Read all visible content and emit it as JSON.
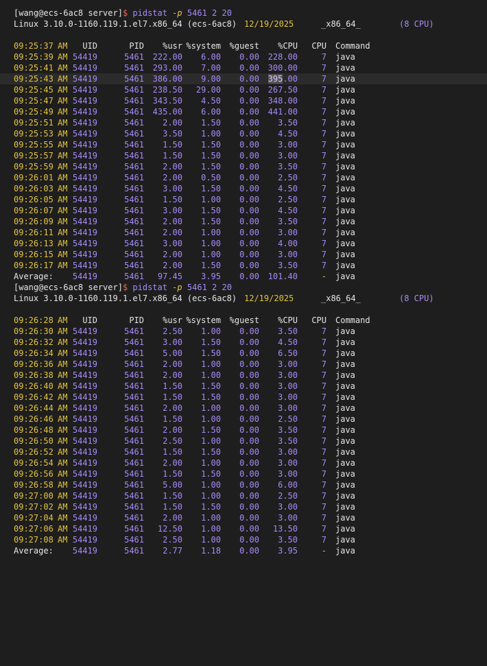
{
  "colors": {
    "background": "#1e1e1e",
    "time": "#e4c440",
    "number": "#a78bfa",
    "text": "#e6e6e6",
    "prompt_red": "#ff5f56"
  },
  "top_partial_line": "",
  "session1": {
    "prompt": {
      "open": "[wang@ecs-6ac8 server]",
      "dollar": "$ ",
      "command": "pidstat",
      "flag": " -p ",
      "args": "5461 2 20"
    },
    "sysinfo": {
      "kernel": "Linux 3.10.0-1160.119.1.el7.x86_64 (ecs-6ac8)",
      "date": "12/19/2025",
      "arch": "_x86_64_",
      "cpus": "(8 CPU)"
    },
    "header": {
      "time": "09:25:37",
      "ampm": "AM",
      "uid": "UID",
      "pid": "PID",
      "usr": "%usr",
      "system": "%system",
      "guest": "%guest",
      "cpu_pct": "%CPU",
      "cpu": "CPU",
      "command": "Command"
    },
    "rows": [
      {
        "time": "09:25:39",
        "ampm": "AM",
        "uid": "54419",
        "pid": "5461",
        "usr": "222.00",
        "system": "6.00",
        "guest": "0.00",
        "cpu_pct": "228.00",
        "cpu": "7",
        "command": "java"
      },
      {
        "time": "09:25:41",
        "ampm": "AM",
        "uid": "54419",
        "pid": "5461",
        "usr": "293.00",
        "system": "7.00",
        "guest": "0.00",
        "cpu_pct": "300.00",
        "cpu": "7",
        "command": "java"
      },
      {
        "time": "09:25:43",
        "ampm": "AM",
        "uid": "54419",
        "pid": "5461",
        "usr": "386.00",
        "system": "9.00",
        "guest": "0.00",
        "cpu_pct": "395.00",
        "cpu": "7",
        "command": "java"
      },
      {
        "time": "09:25:45",
        "ampm": "AM",
        "uid": "54419",
        "pid": "5461",
        "usr": "238.50",
        "system": "29.00",
        "guest": "0.00",
        "cpu_pct": "267.50",
        "cpu": "7",
        "command": "java"
      },
      {
        "time": "09:25:47",
        "ampm": "AM",
        "uid": "54419",
        "pid": "5461",
        "usr": "343.50",
        "system": "4.50",
        "guest": "0.00",
        "cpu_pct": "348.00",
        "cpu": "7",
        "command": "java"
      },
      {
        "time": "09:25:49",
        "ampm": "AM",
        "uid": "54419",
        "pid": "5461",
        "usr": "435.00",
        "system": "6.00",
        "guest": "0.00",
        "cpu_pct": "441.00",
        "cpu": "7",
        "command": "java"
      },
      {
        "time": "09:25:51",
        "ampm": "AM",
        "uid": "54419",
        "pid": "5461",
        "usr": "2.00",
        "system": "1.50",
        "guest": "0.00",
        "cpu_pct": "3.50",
        "cpu": "7",
        "command": "java"
      },
      {
        "time": "09:25:53",
        "ampm": "AM",
        "uid": "54419",
        "pid": "5461",
        "usr": "3.50",
        "system": "1.00",
        "guest": "0.00",
        "cpu_pct": "4.50",
        "cpu": "7",
        "command": "java"
      },
      {
        "time": "09:25:55",
        "ampm": "AM",
        "uid": "54419",
        "pid": "5461",
        "usr": "1.50",
        "system": "1.50",
        "guest": "0.00",
        "cpu_pct": "3.00",
        "cpu": "7",
        "command": "java"
      },
      {
        "time": "09:25:57",
        "ampm": "AM",
        "uid": "54419",
        "pid": "5461",
        "usr": "1.50",
        "system": "1.50",
        "guest": "0.00",
        "cpu_pct": "3.00",
        "cpu": "7",
        "command": "java"
      },
      {
        "time": "09:25:59",
        "ampm": "AM",
        "uid": "54419",
        "pid": "5461",
        "usr": "2.00",
        "system": "1.50",
        "guest": "0.00",
        "cpu_pct": "3.50",
        "cpu": "7",
        "command": "java"
      },
      {
        "time": "09:26:01",
        "ampm": "AM",
        "uid": "54419",
        "pid": "5461",
        "usr": "2.00",
        "system": "0.50",
        "guest": "0.00",
        "cpu_pct": "2.50",
        "cpu": "7",
        "command": "java"
      },
      {
        "time": "09:26:03",
        "ampm": "AM",
        "uid": "54419",
        "pid": "5461",
        "usr": "3.00",
        "system": "1.50",
        "guest": "0.00",
        "cpu_pct": "4.50",
        "cpu": "7",
        "command": "java"
      },
      {
        "time": "09:26:05",
        "ampm": "AM",
        "uid": "54419",
        "pid": "5461",
        "usr": "1.50",
        "system": "1.00",
        "guest": "0.00",
        "cpu_pct": "2.50",
        "cpu": "7",
        "command": "java"
      },
      {
        "time": "09:26:07",
        "ampm": "AM",
        "uid": "54419",
        "pid": "5461",
        "usr": "3.00",
        "system": "1.50",
        "guest": "0.00",
        "cpu_pct": "4.50",
        "cpu": "7",
        "command": "java"
      },
      {
        "time": "09:26:09",
        "ampm": "AM",
        "uid": "54419",
        "pid": "5461",
        "usr": "2.00",
        "system": "1.50",
        "guest": "0.00",
        "cpu_pct": "3.50",
        "cpu": "7",
        "command": "java"
      },
      {
        "time": "09:26:11",
        "ampm": "AM",
        "uid": "54419",
        "pid": "5461",
        "usr": "2.00",
        "system": "1.00",
        "guest": "0.00",
        "cpu_pct": "3.00",
        "cpu": "7",
        "command": "java"
      },
      {
        "time": "09:26:13",
        "ampm": "AM",
        "uid": "54419",
        "pid": "5461",
        "usr": "3.00",
        "system": "1.00",
        "guest": "0.00",
        "cpu_pct": "4.00",
        "cpu": "7",
        "command": "java"
      },
      {
        "time": "09:26:15",
        "ampm": "AM",
        "uid": "54419",
        "pid": "5461",
        "usr": "2.00",
        "system": "1.00",
        "guest": "0.00",
        "cpu_pct": "3.00",
        "cpu": "7",
        "command": "java"
      },
      {
        "time": "09:26:17",
        "ampm": "AM",
        "uid": "54419",
        "pid": "5461",
        "usr": "2.00",
        "system": "1.50",
        "guest": "0.00",
        "cpu_pct": "3.50",
        "cpu": "7",
        "command": "java"
      }
    ],
    "average": {
      "label": "Average:",
      "uid": "54419",
      "pid": "5461",
      "usr": "97.45",
      "system": "3.95",
      "guest": "0.00",
      "cpu_pct": "101.40",
      "cpu": "-",
      "command": "java"
    }
  },
  "session2": {
    "prompt": {
      "open": "[wang@ecs-6ac8 server]",
      "dollar": "$ ",
      "command": "pidstat",
      "flag": " -p ",
      "args": "5461 2 20"
    },
    "sysinfo": {
      "kernel": "Linux 3.10.0-1160.119.1.el7.x86_64 (ecs-6ac8)",
      "date": "12/19/2025",
      "arch": "_x86_64_",
      "cpus": "(8 CPU)"
    },
    "header": {
      "time": "09:26:28",
      "ampm": "AM",
      "uid": "UID",
      "pid": "PID",
      "usr": "%usr",
      "system": "%system",
      "guest": "%guest",
      "cpu_pct": "%CPU",
      "cpu": "CPU",
      "command": "Command"
    },
    "rows": [
      {
        "time": "09:26:30",
        "ampm": "AM",
        "uid": "54419",
        "pid": "5461",
        "usr": "2.50",
        "system": "1.00",
        "guest": "0.00",
        "cpu_pct": "3.50",
        "cpu": "7",
        "command": "java"
      },
      {
        "time": "09:26:32",
        "ampm": "AM",
        "uid": "54419",
        "pid": "5461",
        "usr": "3.00",
        "system": "1.50",
        "guest": "0.00",
        "cpu_pct": "4.50",
        "cpu": "7",
        "command": "java"
      },
      {
        "time": "09:26:34",
        "ampm": "AM",
        "uid": "54419",
        "pid": "5461",
        "usr": "5.00",
        "system": "1.50",
        "guest": "0.00",
        "cpu_pct": "6.50",
        "cpu": "7",
        "command": "java"
      },
      {
        "time": "09:26:36",
        "ampm": "AM",
        "uid": "54419",
        "pid": "5461",
        "usr": "2.00",
        "system": "1.00",
        "guest": "0.00",
        "cpu_pct": "3.00",
        "cpu": "7",
        "command": "java"
      },
      {
        "time": "09:26:38",
        "ampm": "AM",
        "uid": "54419",
        "pid": "5461",
        "usr": "2.00",
        "system": "1.00",
        "guest": "0.00",
        "cpu_pct": "3.00",
        "cpu": "7",
        "command": "java"
      },
      {
        "time": "09:26:40",
        "ampm": "AM",
        "uid": "54419",
        "pid": "5461",
        "usr": "1.50",
        "system": "1.50",
        "guest": "0.00",
        "cpu_pct": "3.00",
        "cpu": "7",
        "command": "java"
      },
      {
        "time": "09:26:42",
        "ampm": "AM",
        "uid": "54419",
        "pid": "5461",
        "usr": "1.50",
        "system": "1.50",
        "guest": "0.00",
        "cpu_pct": "3.00",
        "cpu": "7",
        "command": "java"
      },
      {
        "time": "09:26:44",
        "ampm": "AM",
        "uid": "54419",
        "pid": "5461",
        "usr": "2.00",
        "system": "1.00",
        "guest": "0.00",
        "cpu_pct": "3.00",
        "cpu": "7",
        "command": "java"
      },
      {
        "time": "09:26:46",
        "ampm": "AM",
        "uid": "54419",
        "pid": "5461",
        "usr": "1.50",
        "system": "1.00",
        "guest": "0.00",
        "cpu_pct": "2.50",
        "cpu": "7",
        "command": "java"
      },
      {
        "time": "09:26:48",
        "ampm": "AM",
        "uid": "54419",
        "pid": "5461",
        "usr": "2.00",
        "system": "1.50",
        "guest": "0.00",
        "cpu_pct": "3.50",
        "cpu": "7",
        "command": "java"
      },
      {
        "time": "09:26:50",
        "ampm": "AM",
        "uid": "54419",
        "pid": "5461",
        "usr": "2.50",
        "system": "1.00",
        "guest": "0.00",
        "cpu_pct": "3.50",
        "cpu": "7",
        "command": "java"
      },
      {
        "time": "09:26:52",
        "ampm": "AM",
        "uid": "54419",
        "pid": "5461",
        "usr": "1.50",
        "system": "1.50",
        "guest": "0.00",
        "cpu_pct": "3.00",
        "cpu": "7",
        "command": "java"
      },
      {
        "time": "09:26:54",
        "ampm": "AM",
        "uid": "54419",
        "pid": "5461",
        "usr": "2.00",
        "system": "1.00",
        "guest": "0.00",
        "cpu_pct": "3.00",
        "cpu": "7",
        "command": "java"
      },
      {
        "time": "09:26:56",
        "ampm": "AM",
        "uid": "54419",
        "pid": "5461",
        "usr": "1.50",
        "system": "1.50",
        "guest": "0.00",
        "cpu_pct": "3.00",
        "cpu": "7",
        "command": "java"
      },
      {
        "time": "09:26:58",
        "ampm": "AM",
        "uid": "54419",
        "pid": "5461",
        "usr": "5.00",
        "system": "1.00",
        "guest": "0.00",
        "cpu_pct": "6.00",
        "cpu": "7",
        "command": "java"
      },
      {
        "time": "09:27:00",
        "ampm": "AM",
        "uid": "54419",
        "pid": "5461",
        "usr": "1.50",
        "system": "1.00",
        "guest": "0.00",
        "cpu_pct": "2.50",
        "cpu": "7",
        "command": "java"
      },
      {
        "time": "09:27:02",
        "ampm": "AM",
        "uid": "54419",
        "pid": "5461",
        "usr": "1.50",
        "system": "1.50",
        "guest": "0.00",
        "cpu_pct": "3.00",
        "cpu": "7",
        "command": "java"
      },
      {
        "time": "09:27:04",
        "ampm": "AM",
        "uid": "54419",
        "pid": "5461",
        "usr": "2.00",
        "system": "1.00",
        "guest": "0.00",
        "cpu_pct": "3.00",
        "cpu": "7",
        "command": "java"
      },
      {
        "time": "09:27:06",
        "ampm": "AM",
        "uid": "54419",
        "pid": "5461",
        "usr": "12.50",
        "system": "1.00",
        "guest": "0.00",
        "cpu_pct": "13.50",
        "cpu": "7",
        "command": "java"
      },
      {
        "time": "09:27:08",
        "ampm": "AM",
        "uid": "54419",
        "pid": "5461",
        "usr": "2.50",
        "system": "1.00",
        "guest": "0.00",
        "cpu_pct": "3.50",
        "cpu": "7",
        "command": "java"
      }
    ],
    "average": {
      "label": "Average:",
      "uid": "54419",
      "pid": "5461",
      "usr": "2.77",
      "system": "1.18",
      "guest": "0.00",
      "cpu_pct": "3.95",
      "cpu": "-",
      "command": "java"
    }
  }
}
